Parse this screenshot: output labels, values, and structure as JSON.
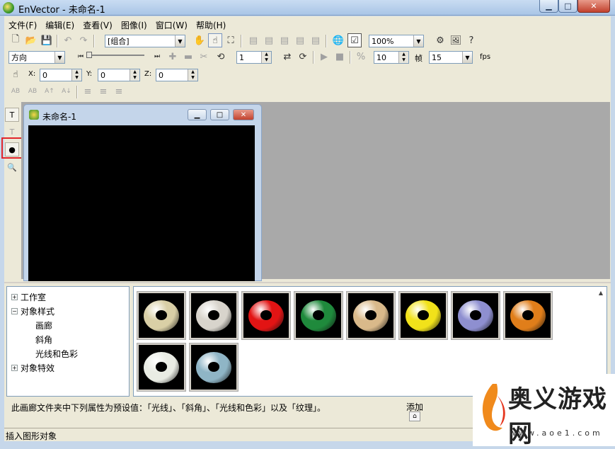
{
  "window": {
    "title": "EnVector - 未命名-1",
    "min": "▁",
    "max": "□",
    "close": "✕"
  },
  "menu": [
    "文件(F)",
    "编辑(E)",
    "查看(V)",
    "图像(I)",
    "窗口(W)",
    "帮助(H)"
  ],
  "toolbar1": {
    "group_combo": "[组合]",
    "zoom_combo": "100%"
  },
  "toolbar2": {
    "direction_combo": "方向",
    "step_value": "1",
    "frames_value": "10",
    "frame_label": "帧",
    "fps_value": "15",
    "fps_label": "fps"
  },
  "toolbar3": {
    "x_label": "X:",
    "x_value": "0",
    "y_label": "Y:",
    "y_value": "0",
    "z_label": "Z:",
    "z_value": "0"
  },
  "toolbar4": [
    "AB",
    "AB",
    "A↑",
    "A↓"
  ],
  "document": {
    "title": "未命名-1"
  },
  "tree": {
    "studio": "工作室",
    "object_style": "对象样式",
    "gallery": "画廊",
    "bevel": "斜角",
    "lighting": "光线和色彩",
    "object_effects": "对象特效",
    "expand": "+",
    "collapse": "−"
  },
  "gallery": {
    "rings": [
      {
        "color": "#d9cfa6"
      },
      {
        "color": "#d8d4cc"
      },
      {
        "color": "#e21414"
      },
      {
        "color": "#1f8a3c"
      },
      {
        "color": "#d9b98a"
      },
      {
        "color": "#f1e21a"
      },
      {
        "color": "#8e8fd0"
      },
      {
        "color": "#e07e1a"
      },
      {
        "color": "#e9ece4"
      },
      {
        "color": "#8fb5c6"
      }
    ]
  },
  "description": "此画廊文件夹中下列属性为预设值：「光线」、「斜角」、「光线和色彩」以及「纹理」。",
  "add_label": "添加",
  "status": "插入图形对象",
  "watermark": {
    "text": "奥义游戏网",
    "url": "www.aoe1.com"
  },
  "colors": {
    "highlight": "#e2262b",
    "canvas": "#000000",
    "workspace": "#a9a9a9"
  }
}
